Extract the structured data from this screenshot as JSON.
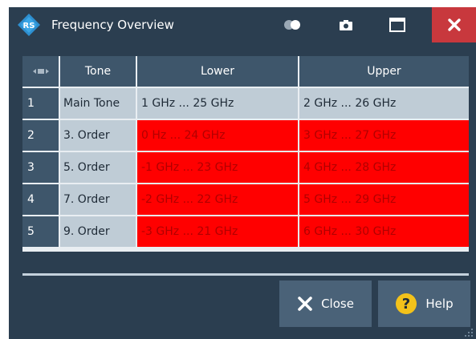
{
  "window": {
    "title": "Frequency Overview"
  },
  "table": {
    "headers": {
      "tone": "Tone",
      "lower": "Lower",
      "upper": "Upper"
    },
    "rows": [
      {
        "index": "1",
        "tone": "Main Tone",
        "lower": "1 GHz ... 25 GHz",
        "upper": "2 GHz ... 26 GHz",
        "status": "ok"
      },
      {
        "index": "2",
        "tone": "3. Order",
        "lower": "0 Hz ... 24 GHz",
        "upper": "3 GHz ... 27 GHz",
        "status": "out-of-range"
      },
      {
        "index": "3",
        "tone": "5. Order",
        "lower": "-1 GHz ... 23 GHz",
        "upper": "4 GHz ... 28 GHz",
        "status": "out-of-range"
      },
      {
        "index": "4",
        "tone": "7. Order",
        "lower": "-2 GHz ... 22 GHz",
        "upper": "5 GHz ... 29 GHz",
        "status": "out-of-range"
      },
      {
        "index": "5",
        "tone": "9. Order",
        "lower": "-3 GHz ... 21 GHz",
        "upper": "6 GHz ... 30 GHz",
        "status": "out-of-range"
      }
    ]
  },
  "buttons": {
    "close_label": "Close",
    "help_label": "Help"
  },
  "icons": {
    "logo": "rohde-schwarz-logo-icon",
    "toggle": "toggle-icon",
    "camera": "camera-icon",
    "maximize": "maximize-icon",
    "close_window": "close-icon",
    "close_button": "x-icon",
    "help": "question-mark-icon"
  },
  "colors": {
    "window_bg": "#2b3e50",
    "header_bg": "#3e566b",
    "cell_ok_bg": "#bfccd6",
    "cell_error_bg": "#ff0000",
    "cell_error_text": "#b10000",
    "close_window_bg": "#c8383d",
    "button_bg": "#4a6278",
    "help_icon": "#f3c21a"
  }
}
